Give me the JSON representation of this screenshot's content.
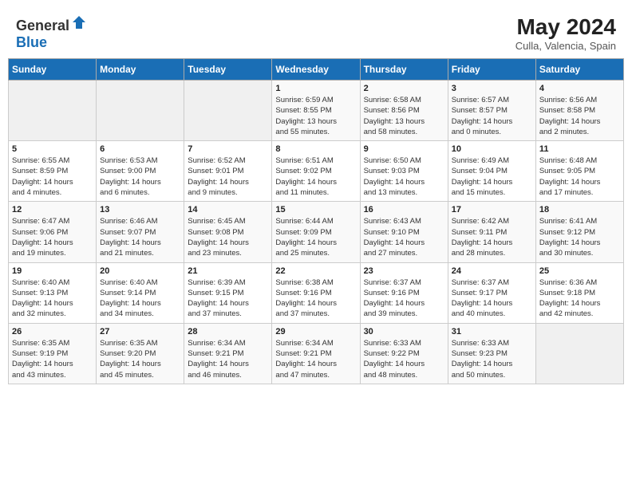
{
  "header": {
    "logo_general": "General",
    "logo_blue": "Blue",
    "month_year": "May 2024",
    "location": "Culla, Valencia, Spain"
  },
  "weekdays": [
    "Sunday",
    "Monday",
    "Tuesday",
    "Wednesday",
    "Thursday",
    "Friday",
    "Saturday"
  ],
  "weeks": [
    [
      {
        "day": "",
        "info": ""
      },
      {
        "day": "",
        "info": ""
      },
      {
        "day": "",
        "info": ""
      },
      {
        "day": "1",
        "info": "Sunrise: 6:59 AM\nSunset: 8:55 PM\nDaylight: 13 hours\nand 55 minutes."
      },
      {
        "day": "2",
        "info": "Sunrise: 6:58 AM\nSunset: 8:56 PM\nDaylight: 13 hours\nand 58 minutes."
      },
      {
        "day": "3",
        "info": "Sunrise: 6:57 AM\nSunset: 8:57 PM\nDaylight: 14 hours\nand 0 minutes."
      },
      {
        "day": "4",
        "info": "Sunrise: 6:56 AM\nSunset: 8:58 PM\nDaylight: 14 hours\nand 2 minutes."
      }
    ],
    [
      {
        "day": "5",
        "info": "Sunrise: 6:55 AM\nSunset: 8:59 PM\nDaylight: 14 hours\nand 4 minutes."
      },
      {
        "day": "6",
        "info": "Sunrise: 6:53 AM\nSunset: 9:00 PM\nDaylight: 14 hours\nand 6 minutes."
      },
      {
        "day": "7",
        "info": "Sunrise: 6:52 AM\nSunset: 9:01 PM\nDaylight: 14 hours\nand 9 minutes."
      },
      {
        "day": "8",
        "info": "Sunrise: 6:51 AM\nSunset: 9:02 PM\nDaylight: 14 hours\nand 11 minutes."
      },
      {
        "day": "9",
        "info": "Sunrise: 6:50 AM\nSunset: 9:03 PM\nDaylight: 14 hours\nand 13 minutes."
      },
      {
        "day": "10",
        "info": "Sunrise: 6:49 AM\nSunset: 9:04 PM\nDaylight: 14 hours\nand 15 minutes."
      },
      {
        "day": "11",
        "info": "Sunrise: 6:48 AM\nSunset: 9:05 PM\nDaylight: 14 hours\nand 17 minutes."
      }
    ],
    [
      {
        "day": "12",
        "info": "Sunrise: 6:47 AM\nSunset: 9:06 PM\nDaylight: 14 hours\nand 19 minutes."
      },
      {
        "day": "13",
        "info": "Sunrise: 6:46 AM\nSunset: 9:07 PM\nDaylight: 14 hours\nand 21 minutes."
      },
      {
        "day": "14",
        "info": "Sunrise: 6:45 AM\nSunset: 9:08 PM\nDaylight: 14 hours\nand 23 minutes."
      },
      {
        "day": "15",
        "info": "Sunrise: 6:44 AM\nSunset: 9:09 PM\nDaylight: 14 hours\nand 25 minutes."
      },
      {
        "day": "16",
        "info": "Sunrise: 6:43 AM\nSunset: 9:10 PM\nDaylight: 14 hours\nand 27 minutes."
      },
      {
        "day": "17",
        "info": "Sunrise: 6:42 AM\nSunset: 9:11 PM\nDaylight: 14 hours\nand 28 minutes."
      },
      {
        "day": "18",
        "info": "Sunrise: 6:41 AM\nSunset: 9:12 PM\nDaylight: 14 hours\nand 30 minutes."
      }
    ],
    [
      {
        "day": "19",
        "info": "Sunrise: 6:40 AM\nSunset: 9:13 PM\nDaylight: 14 hours\nand 32 minutes."
      },
      {
        "day": "20",
        "info": "Sunrise: 6:40 AM\nSunset: 9:14 PM\nDaylight: 14 hours\nand 34 minutes."
      },
      {
        "day": "21",
        "info": "Sunrise: 6:39 AM\nSunset: 9:15 PM\nDaylight: 14 hours\nand 37 minutes."
      },
      {
        "day": "22",
        "info": "Sunrise: 6:38 AM\nSunset: 9:16 PM\nDaylight: 14 hours\nand 37 minutes."
      },
      {
        "day": "23",
        "info": "Sunrise: 6:37 AM\nSunset: 9:16 PM\nDaylight: 14 hours\nand 39 minutes."
      },
      {
        "day": "24",
        "info": "Sunrise: 6:37 AM\nSunset: 9:17 PM\nDaylight: 14 hours\nand 40 minutes."
      },
      {
        "day": "25",
        "info": "Sunrise: 6:36 AM\nSunset: 9:18 PM\nDaylight: 14 hours\nand 42 minutes."
      }
    ],
    [
      {
        "day": "26",
        "info": "Sunrise: 6:35 AM\nSunset: 9:19 PM\nDaylight: 14 hours\nand 43 minutes."
      },
      {
        "day": "27",
        "info": "Sunrise: 6:35 AM\nSunset: 9:20 PM\nDaylight: 14 hours\nand 45 minutes."
      },
      {
        "day": "28",
        "info": "Sunrise: 6:34 AM\nSunset: 9:21 PM\nDaylight: 14 hours\nand 46 minutes."
      },
      {
        "day": "29",
        "info": "Sunrise: 6:34 AM\nSunset: 9:21 PM\nDaylight: 14 hours\nand 47 minutes."
      },
      {
        "day": "30",
        "info": "Sunrise: 6:33 AM\nSunset: 9:22 PM\nDaylight: 14 hours\nand 48 minutes."
      },
      {
        "day": "31",
        "info": "Sunrise: 6:33 AM\nSunset: 9:23 PM\nDaylight: 14 hours\nand 50 minutes."
      },
      {
        "day": "",
        "info": ""
      }
    ]
  ]
}
